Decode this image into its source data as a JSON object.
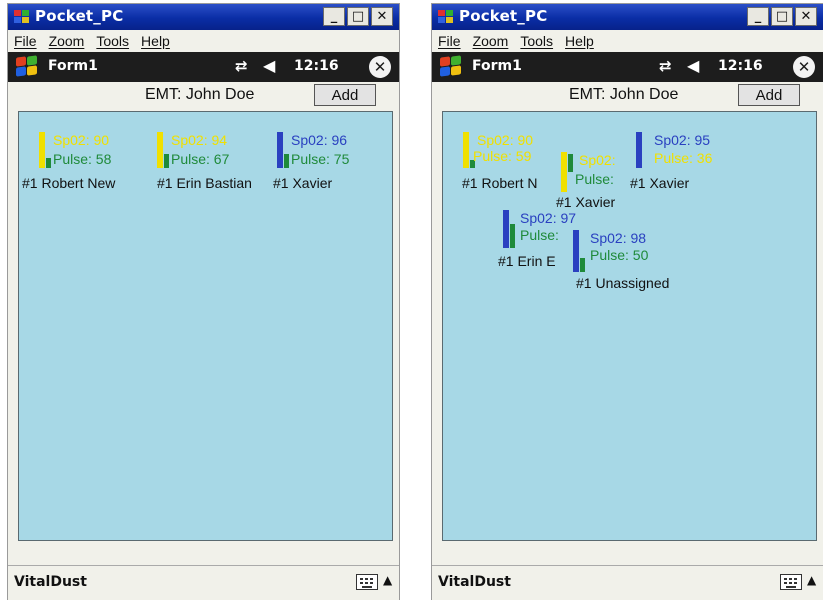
{
  "left": {
    "window_title": "Pocket_PC",
    "menu": [
      "File",
      "Zoom",
      "Tools",
      "Help"
    ],
    "form_title": "Form1",
    "clock": "12:16",
    "emt_label": "EMT: John Doe",
    "add_label": "Add",
    "bottom_app": "VitalDust",
    "sensors": [
      {
        "spo2": "Sp02: 90",
        "pulse": "Pulse: 58",
        "name": "#1 Robert New",
        "color": "#f0e000"
      },
      {
        "spo2": "Sp02: 94",
        "pulse": "Pulse: 67",
        "name": "#1 Erin Bastian",
        "color": "#f0e000"
      },
      {
        "spo2": "Sp02: 96",
        "pulse": "Pulse: 75",
        "name": "#1 Xavier",
        "color": "#2a40c0"
      }
    ]
  },
  "right": {
    "window_title": "Pocket_PC",
    "menu": [
      "File",
      "Zoom",
      "Tools",
      "Help"
    ],
    "form_title": "Form1",
    "clock": "12:16",
    "emt_label": "EMT: John Doe",
    "add_label": "Add",
    "bottom_app": "VitalDust",
    "sensors": [
      {
        "spo2": "Sp02: 90",
        "pulse": "Pulse: 59",
        "name": "#1 Robert N",
        "color": "#f0e000"
      },
      {
        "spo2": "Sp02:",
        "pulse": "Pulse:",
        "name": "#1 Xavier",
        "color": "#f0e000"
      },
      {
        "spo2": "Sp02: 95",
        "pulse": "Pulse: 36",
        "name": "#1 Xavier",
        "color": "#2a40c0"
      },
      {
        "spo2": "Sp02: 97",
        "pulse": "Pulse:",
        "name": "#1 Erin E",
        "color": "#2a40c0"
      },
      {
        "spo2": "Sp02: 98",
        "pulse": "Pulse: 50",
        "name": "#1 Unassigned",
        "color": "#2a40c0"
      }
    ]
  },
  "colors": {
    "spo2_yellow": "#f0e000",
    "spo2_blue": "#2a40c0",
    "pulse_green": "#1f8a3a",
    "canvas_bg": "#a7d8e6"
  },
  "icons": [
    "windows-start-icon",
    "network-icon",
    "speaker-icon",
    "close-icon",
    "keyboard-icon"
  ]
}
